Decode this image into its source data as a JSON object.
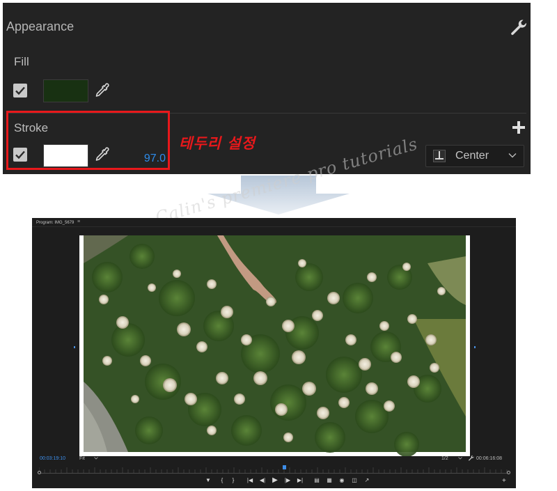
{
  "appearance": {
    "title": "Appearance",
    "fill": {
      "label": "Fill",
      "checked": true,
      "color": "#183112"
    },
    "stroke": {
      "label": "Stroke",
      "checked": true,
      "color": "#ffffff",
      "width": "97.0"
    },
    "stroke_alignment": {
      "value": "Center"
    }
  },
  "annotation": {
    "text": "테두리 설정",
    "color": "#e8181b"
  },
  "watermark": {
    "text": "Calin's premiere pro tutorials"
  },
  "program_monitor": {
    "tab": "Program: IMG_5679",
    "tab_menu_icon": "hamburger-icon",
    "timecode_current": "00:03:19:10",
    "zoom": "Fit",
    "resolution": "1/2",
    "timecode_duration": "00:06:16:08",
    "playhead_fraction": 0.52,
    "transport": [
      "marker-icon",
      "mark-in-icon",
      "mark-out-icon",
      "go-to-in-icon",
      "step-back-icon",
      "play-icon",
      "step-forward-icon",
      "go-to-out-icon",
      "lift-icon",
      "extract-icon",
      "export-frame-icon",
      "compare-icon",
      "share-icon"
    ]
  },
  "colors": {
    "panel_bg": "#232323",
    "highlight": "#e8181b",
    "accent_blue": "#2d8ceb"
  }
}
